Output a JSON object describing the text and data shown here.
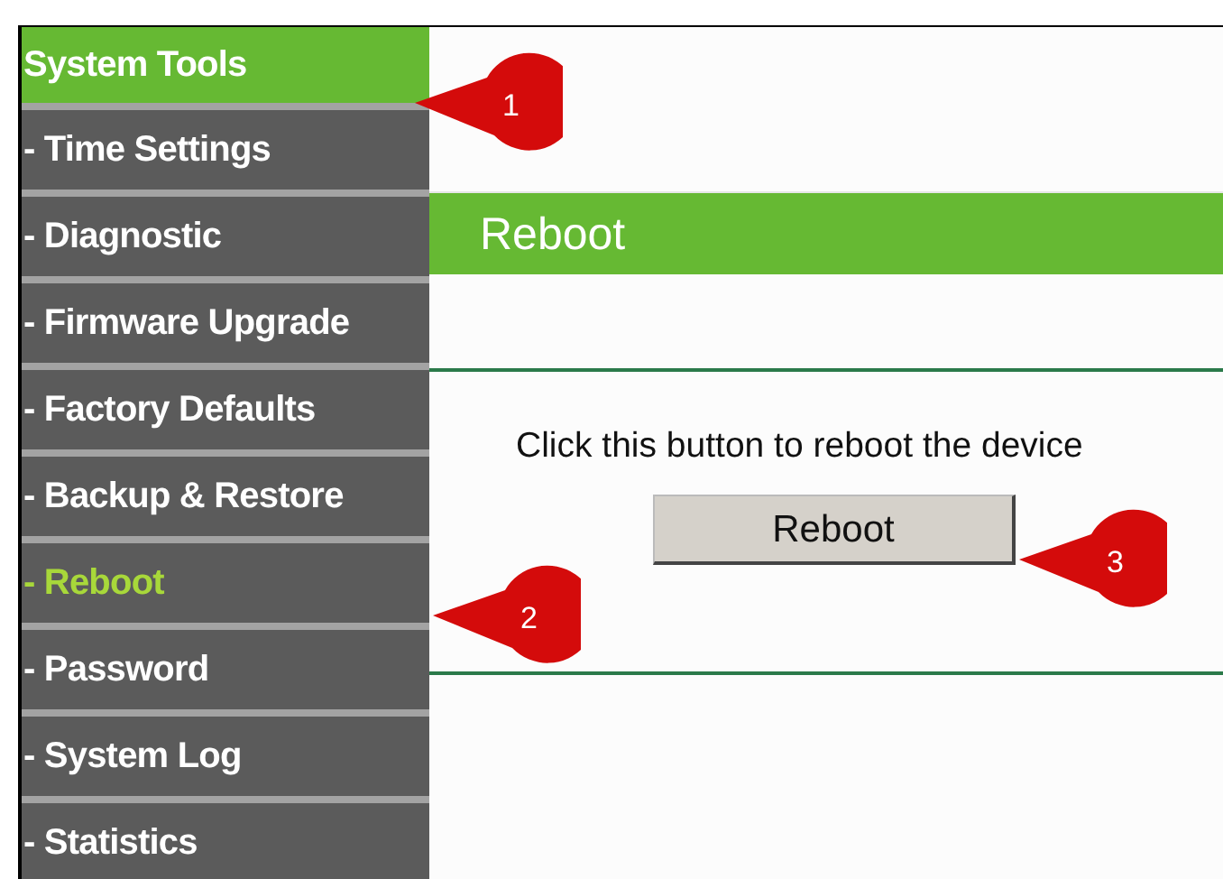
{
  "sidebar": {
    "items": [
      {
        "label": "System Tools",
        "kind": "header",
        "selected": false
      },
      {
        "label": "- Time Settings",
        "kind": "item",
        "selected": false
      },
      {
        "label": "- Diagnostic",
        "kind": "item",
        "selected": false
      },
      {
        "label": "- Firmware Upgrade",
        "kind": "item",
        "selected": false
      },
      {
        "label": "- Factory Defaults",
        "kind": "item",
        "selected": false
      },
      {
        "label": "- Backup & Restore",
        "kind": "item",
        "selected": false
      },
      {
        "label": "- Reboot",
        "kind": "item",
        "selected": true
      },
      {
        "label": "- Password",
        "kind": "item",
        "selected": false
      },
      {
        "label": "- System Log",
        "kind": "item",
        "selected": false
      },
      {
        "label": "- Statistics",
        "kind": "item",
        "selected": false
      }
    ]
  },
  "panel": {
    "title": "Reboot",
    "description": "Click this button to reboot the device",
    "button": "Reboot"
  },
  "callouts": [
    {
      "number": "1"
    },
    {
      "number": "2"
    },
    {
      "number": "3"
    }
  ]
}
